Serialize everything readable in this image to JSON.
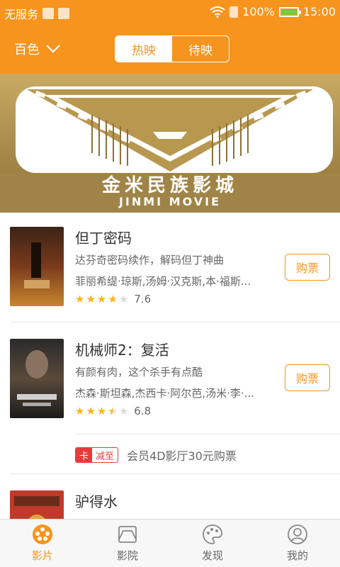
{
  "status_bar": {
    "carrier": "无服务",
    "battery": "100%",
    "battery_level": 1.0,
    "time": "15:00",
    "icons": [
      "image-icon",
      "usb-icon",
      "wifi-icon",
      "sim-icon",
      "battery-icon"
    ]
  },
  "header": {
    "city": "百色",
    "tabs": [
      {
        "label": "热映",
        "active": true
      },
      {
        "label": "待映",
        "active": false
      }
    ]
  },
  "banner": {
    "title_cn": "金米民族影城",
    "title_en": "JINMI MOVIE"
  },
  "movies": [
    {
      "title": "但丁密码",
      "desc": "达芬奇密码续作，解码但丁神曲",
      "cast": "菲丽希缇·琼斯,汤姆·汉克斯,本·福斯...",
      "rating": 7.6,
      "score": "7.6",
      "stars": 4,
      "buy_label": "购票",
      "poster_colors": [
        "#3b2416",
        "#7a3a1c",
        "#c8862e"
      ]
    },
    {
      "title": "机械师2：复活",
      "desc": "有颜有肉，这个杀手有点酷",
      "cast": "杰森·斯坦森,杰西卡·阿尔芭,汤米·李·...",
      "rating": 6.8,
      "score": "6.8",
      "stars": 3.5,
      "buy_label": "购票",
      "poster_colors": [
        "#1c1c1c",
        "#5a4a3a",
        "#a8a8a8"
      ]
    },
    {
      "title": "驴得水",
      "poster_colors": [
        "#c0392b",
        "#6b2c1a",
        "#e6a23c"
      ]
    }
  ],
  "promo": {
    "tag_a": "卡",
    "tag_b": "减至",
    "text": "会员4D影厅30元购票"
  },
  "tabbar": [
    {
      "label": "影片",
      "icon": "film-reel-icon",
      "active": true
    },
    {
      "label": "影院",
      "icon": "cinema-icon",
      "active": false
    },
    {
      "label": "发现",
      "icon": "palette-icon",
      "active": false
    },
    {
      "label": "我的",
      "icon": "user-icon",
      "active": false
    }
  ],
  "colors": {
    "accent": "#f7941d",
    "star": "#f8b41b",
    "promo_red": "#e83a3a",
    "banner_gold": "#a98c4f"
  }
}
